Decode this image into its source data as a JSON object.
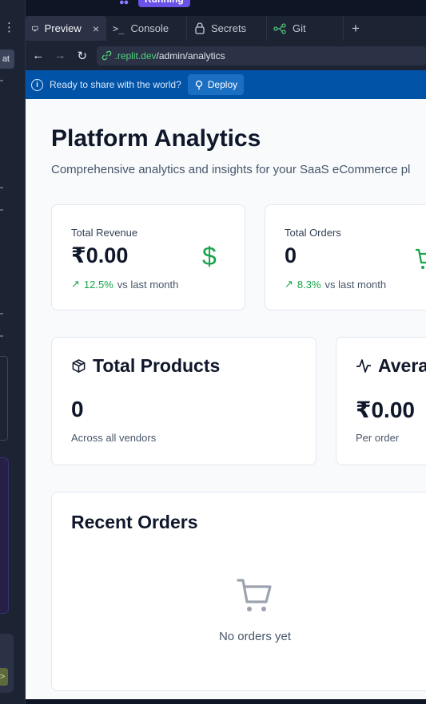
{
  "workspace": {
    "status_label": "Running"
  },
  "tabs": [
    {
      "label": "Preview",
      "icon": "monitor-icon",
      "active": true
    },
    {
      "label": "Console",
      "icon": "terminal-icon",
      "active": false
    },
    {
      "label": "Secrets",
      "icon": "lock-icon",
      "active": false
    },
    {
      "label": "Git",
      "icon": "git-branch-icon",
      "active": false
    }
  ],
  "tab_add": "+",
  "address_bar": {
    "host": ".replit.dev",
    "path": "/admin/analytics"
  },
  "banner": {
    "text": "Ready to share with the world?",
    "deploy_label": "Deploy"
  },
  "page": {
    "title": "Platform Analytics",
    "subtitle": "Comprehensive analytics and insights for your SaaS eCommerce pl"
  },
  "stats": [
    {
      "label": "Total Revenue",
      "value": "₹0.00",
      "icon": "dollar-icon",
      "change_pct": "12.5%",
      "change_text": "vs last month"
    },
    {
      "label": "Total Orders",
      "value": "0",
      "icon": "cart-icon",
      "change_pct": "8.3%",
      "change_text": "vs last month"
    }
  ],
  "metrics": [
    {
      "title": "Total Products",
      "icon": "package-icon",
      "value": "0",
      "sub": "Across all vendors"
    },
    {
      "title": "Averag",
      "icon": "activity-icon",
      "value": "₹0.00",
      "sub": "Per order"
    }
  ],
  "recent_orders": {
    "title": "Recent Orders",
    "empty_text": "No orders yet"
  },
  "colors": {
    "accent_green": "#16a34a",
    "banner_blue": "#0053a6",
    "running_purple": "#6a52e8"
  }
}
